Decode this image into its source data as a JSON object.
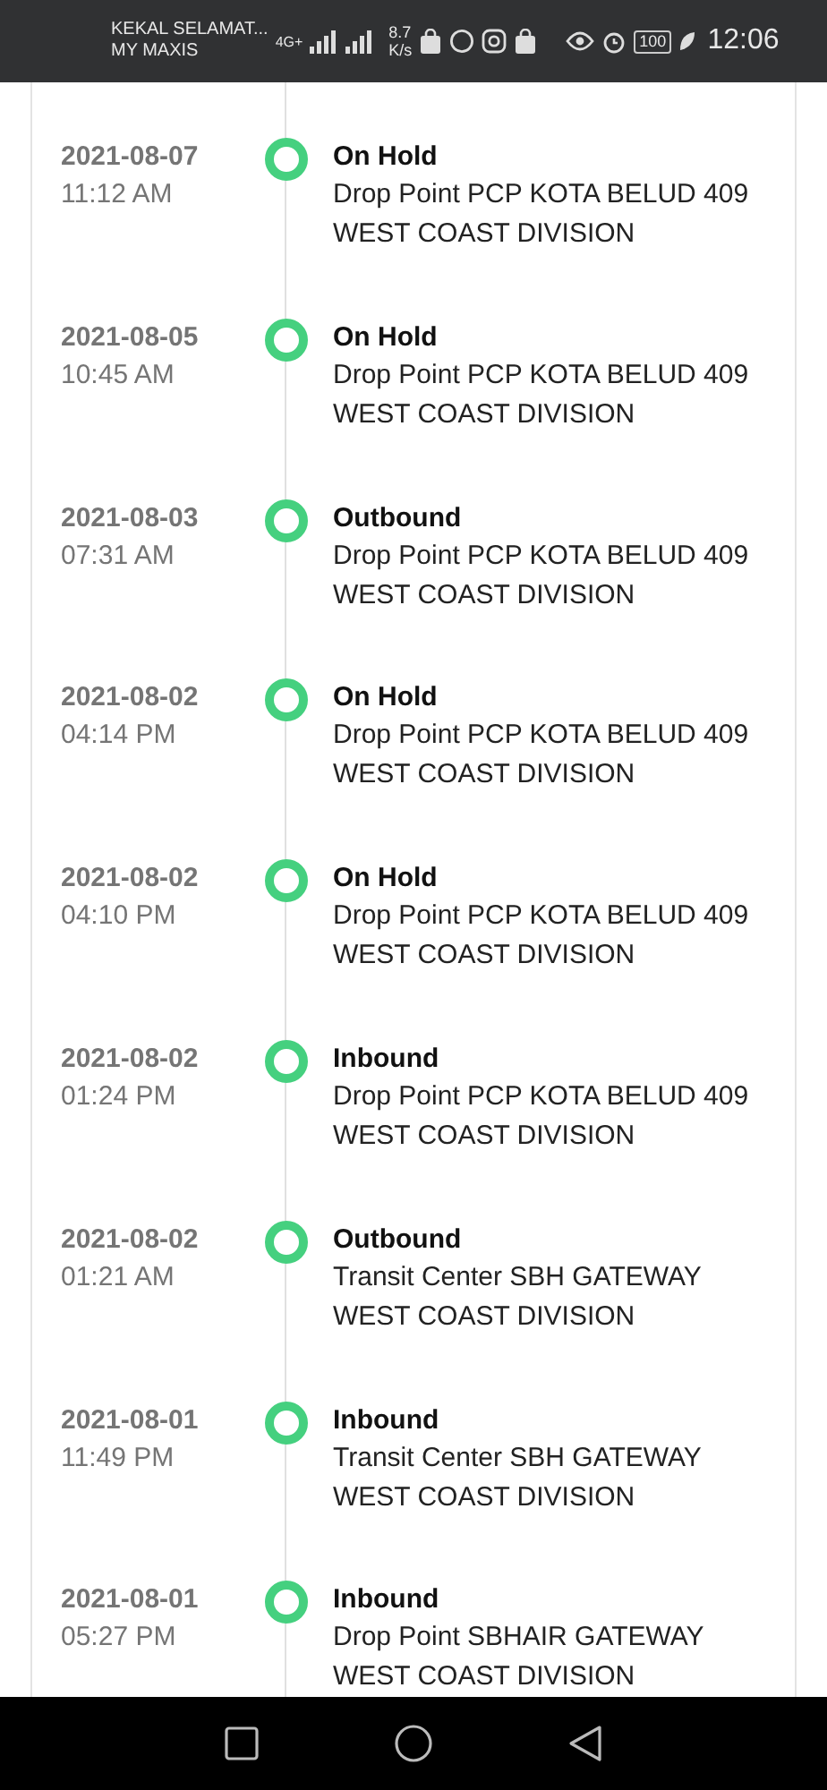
{
  "status_bar": {
    "carrier": "KEKAL SELAMAT...",
    "carrier_2": "MY MAXIS",
    "network": "4G+",
    "speed": "8.7",
    "speed_unit": "K/s",
    "battery": "100",
    "time": "12:06"
  },
  "events": [
    {
      "date": "2021-08-07",
      "time": "11:12 AM",
      "status": "On Hold",
      "location": "Drop Point PCP KOTA BELUD 409 WEST COAST DIVISION"
    },
    {
      "date": "2021-08-05",
      "time": "10:45 AM",
      "status": "On Hold",
      "location": "Drop Point PCP KOTA BELUD 409 WEST COAST DIVISION"
    },
    {
      "date": "2021-08-03",
      "time": "07:31 AM",
      "status": "Outbound",
      "location": "Drop Point PCP KOTA BELUD 409 WEST COAST DIVISION"
    },
    {
      "date": "2021-08-02",
      "time": "04:14 PM",
      "status": "On Hold",
      "location": "Drop Point PCP KOTA BELUD 409 WEST COAST DIVISION"
    },
    {
      "date": "2021-08-02",
      "time": "04:10 PM",
      "status": "On Hold",
      "location": "Drop Point PCP KOTA BELUD 409 WEST COAST DIVISION"
    },
    {
      "date": "2021-08-02",
      "time": "01:24 PM",
      "status": "Inbound",
      "location": "Drop Point PCP KOTA BELUD 409 WEST COAST DIVISION"
    },
    {
      "date": "2021-08-02",
      "time": "01:21 AM",
      "status": "Outbound",
      "location": "Transit Center SBH GATEWAY WEST COAST DIVISION"
    },
    {
      "date": "2021-08-01",
      "time": "11:49 PM",
      "status": "Inbound",
      "location": "Transit Center SBH GATEWAY WEST COAST DIVISION"
    },
    {
      "date": "2021-08-01",
      "time": "05:27 PM",
      "status": "Inbound",
      "location": "Drop Point SBHAIR GATEWAY WEST COAST DIVISION"
    }
  ]
}
